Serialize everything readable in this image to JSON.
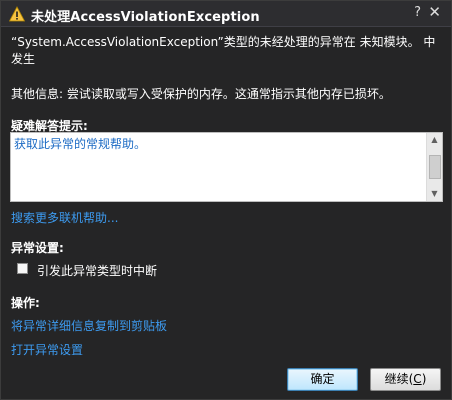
{
  "dialog": {
    "title": "未处理AccessViolationException",
    "help_glyph": "?",
    "close_glyph": "✕",
    "message": "“System.AccessViolationException”类型的未经处理的异常在 未知模块。 中发生",
    "additional_info": "其他信息: 尝试读取或写入受保护的内存。这通常指示其他内存已损坏。",
    "troubleshooting": {
      "label": "疑难解答提示:",
      "tip_link": "获取此异常的常规帮助。"
    },
    "search_online_link": "搜索更多联机帮助...",
    "exception_settings": {
      "label": "异常设置:",
      "checkbox_label": "引发此异常类型时中断",
      "checked": false
    },
    "actions": {
      "label": "操作:",
      "copy_details": "将异常详细信息复制到剪贴板",
      "open_settings": "打开异常设置"
    },
    "buttons": {
      "ok": "确定",
      "continue_prefix": "继续(",
      "continue_key": "C",
      "continue_suffix": ")"
    },
    "icons": {
      "title": "warning-icon"
    },
    "colors": {
      "link": "#3d9bf0",
      "tip_link": "#1c6bc4",
      "background": "#252526"
    }
  }
}
